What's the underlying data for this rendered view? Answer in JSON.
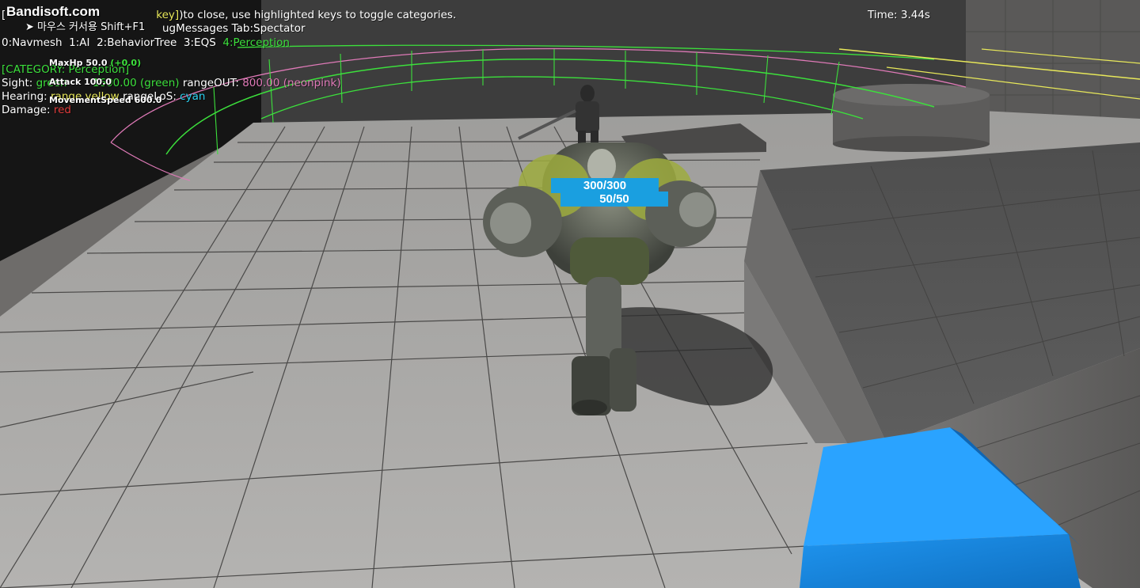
{
  "watermark": "Bandisoft.com",
  "capture_hint": "마우스 커서용 Shift+F1",
  "debug": {
    "line1_prefix": "[",
    "line1_key": "key]",
    "line1_rest": ")to close, use highlighted keys to toggle categories.",
    "line2": "ugMessages  Tab:Spectator",
    "categories": [
      "0:Navmesh",
      "1:AI",
      "2:BehaviorTree",
      "3:EQS",
      "4:Perception"
    ],
    "category_header": "[CATEGORY: Perception]",
    "sight_label": "Sight: ",
    "sight_green": "green",
    "sight_in": " 1600.00 (green)",
    "sight_out_label": " rangeOUT: ",
    "sight_out": "800.00 (neonpink)",
    "hearing_label": "Hearing: ",
    "hearing_range": "range yellow",
    "hearing_los_label": " rangeLoS: ",
    "hearing_los": "cyan",
    "damage_label": "Damage: ",
    "damage_color": "red"
  },
  "stats": {
    "maxhp_label": "MaxHp 50.0",
    "maxhp_delta": "(+0.0)",
    "attack_label": "Attack 100.0",
    "movement_label": "MovementSpeed 600.0"
  },
  "timer": "Time: 3.44s",
  "health_bar": "300/300",
  "mana_bar": "50/50",
  "colors": {
    "floor": "#a8a7a5",
    "grid_line": "#4a4948",
    "wall_dark": "#3b3b3b",
    "perception_green": "#3ce03c",
    "perception_pink": "#e07ab8",
    "hearing_yellow": "#e8e85a",
    "bar_blue": "#1a9fe0",
    "cube_blue": "#1a8ae6"
  },
  "icons": [
    "cursor-icon"
  ]
}
